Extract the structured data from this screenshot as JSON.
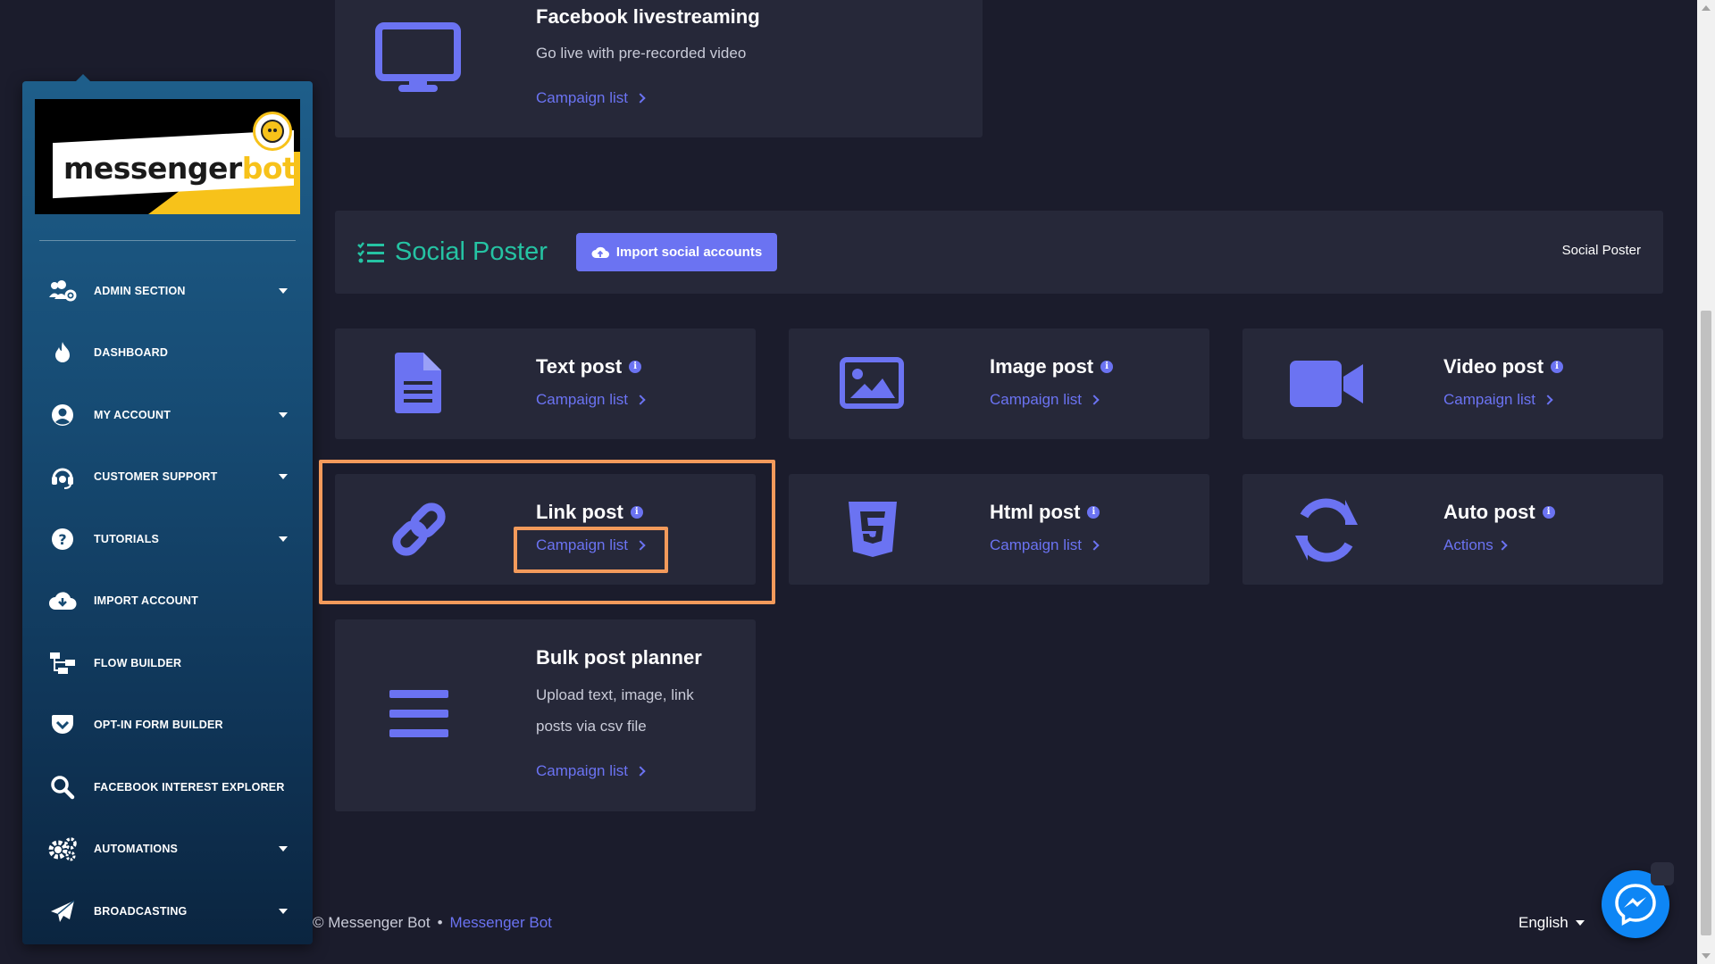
{
  "sidebar": {
    "logo": {
      "text_main": "messenger",
      "text_accent": "bot"
    },
    "items": [
      {
        "label": "ADMIN SECTION",
        "icon": "users-gear-icon",
        "has_caret": true
      },
      {
        "label": "DASHBOARD",
        "icon": "fire-icon",
        "has_caret": false
      },
      {
        "label": "MY ACCOUNT",
        "icon": "user-circle-icon",
        "has_caret": true
      },
      {
        "label": "CUSTOMER SUPPORT",
        "icon": "headset-icon",
        "has_caret": true
      },
      {
        "label": "TUTORIALS",
        "icon": "question-circle-icon",
        "has_caret": true
      },
      {
        "label": "IMPORT ACCOUNT",
        "icon": "cloud-download-icon",
        "has_caret": false
      },
      {
        "label": "FLOW BUILDER",
        "icon": "sitemap-icon",
        "has_caret": false
      },
      {
        "label": "OPT-IN FORM BUILDER",
        "icon": "pocket-icon",
        "has_caret": false
      },
      {
        "label": "FACEBOOK INTEREST EXPLORER",
        "icon": "search-icon",
        "has_caret": false
      },
      {
        "label": "AUTOMATIONS",
        "icon": "cogs-icon",
        "has_caret": true
      },
      {
        "label": "BROADCASTING",
        "icon": "paper-plane-icon",
        "has_caret": true
      }
    ]
  },
  "livestream_card": {
    "title": "Facebook livestreaming",
    "description": "Go live with pre-recorded video",
    "link": "Campaign list"
  },
  "social_poster": {
    "title": "Social Poster",
    "import_button": "Import social accounts",
    "breadcrumb": "Social Poster"
  },
  "posts": {
    "text": {
      "title": "Text post",
      "link": "Campaign list",
      "info": "i"
    },
    "image": {
      "title": "Image post",
      "link": "Campaign list",
      "info": "i"
    },
    "video": {
      "title": "Video post",
      "link": "Campaign list",
      "info": "i"
    },
    "link": {
      "title": "Link post",
      "link": "Campaign list",
      "info": "i"
    },
    "html": {
      "title": "Html post",
      "link": "Campaign list",
      "info": "i"
    },
    "auto": {
      "title": "Auto post",
      "link": "Actions",
      "info": "i"
    },
    "bulk": {
      "title": "Bulk post planner",
      "description_line1": "Upload text, image, link",
      "description_line2": "posts via csv file",
      "link": "Campaign list"
    }
  },
  "footer": {
    "copyright": "© Messenger Bot",
    "separator": "•",
    "brand_link": "Messenger Bot",
    "language": "English"
  },
  "colors": {
    "background": "#1b1c2c",
    "card": "#262839",
    "accent": "#6b73f2",
    "teal": "#25c3a3",
    "highlight": "#f39a5b",
    "messenger": "#0e86f5"
  }
}
